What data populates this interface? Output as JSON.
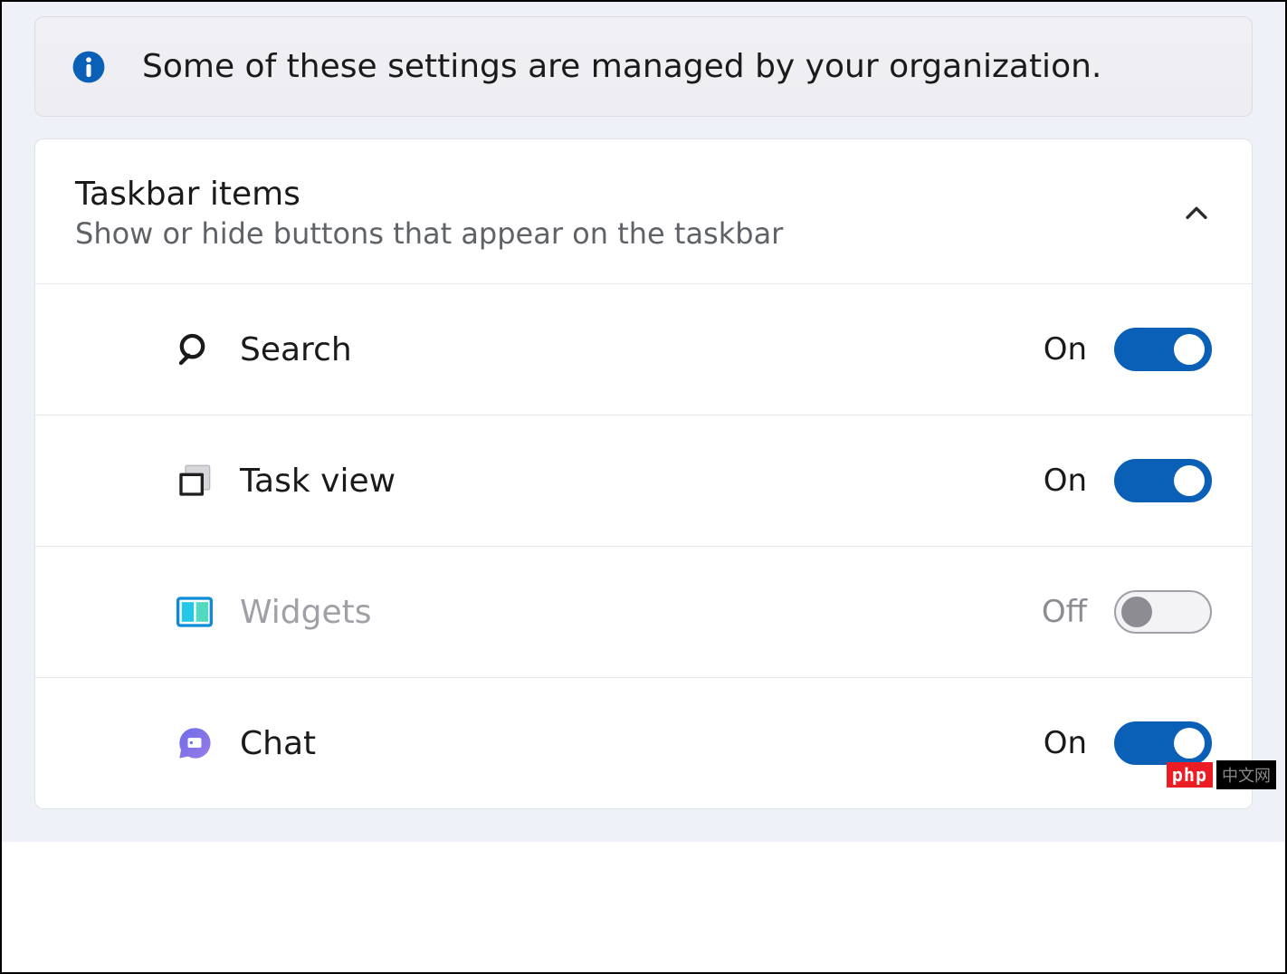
{
  "banner": {
    "text": "Some of these settings are managed by your organization."
  },
  "section": {
    "title": "Taskbar items",
    "subtitle": "Show or hide buttons that appear on the taskbar",
    "expanded": true
  },
  "items": [
    {
      "icon": "search-icon",
      "label": "Search",
      "status": "On",
      "on": true,
      "disabled": false
    },
    {
      "icon": "taskview-icon",
      "label": "Task view",
      "status": "On",
      "on": true,
      "disabled": false
    },
    {
      "icon": "widgets-icon",
      "label": "Widgets",
      "status": "Off",
      "on": false,
      "disabled": true
    },
    {
      "icon": "chat-icon",
      "label": "Chat",
      "status": "On",
      "on": true,
      "disabled": false
    }
  ],
  "colors": {
    "accent": "#0a5fb7",
    "info_icon": "#0a5fb7"
  },
  "watermark": {
    "left": "php",
    "right": "中文网"
  }
}
